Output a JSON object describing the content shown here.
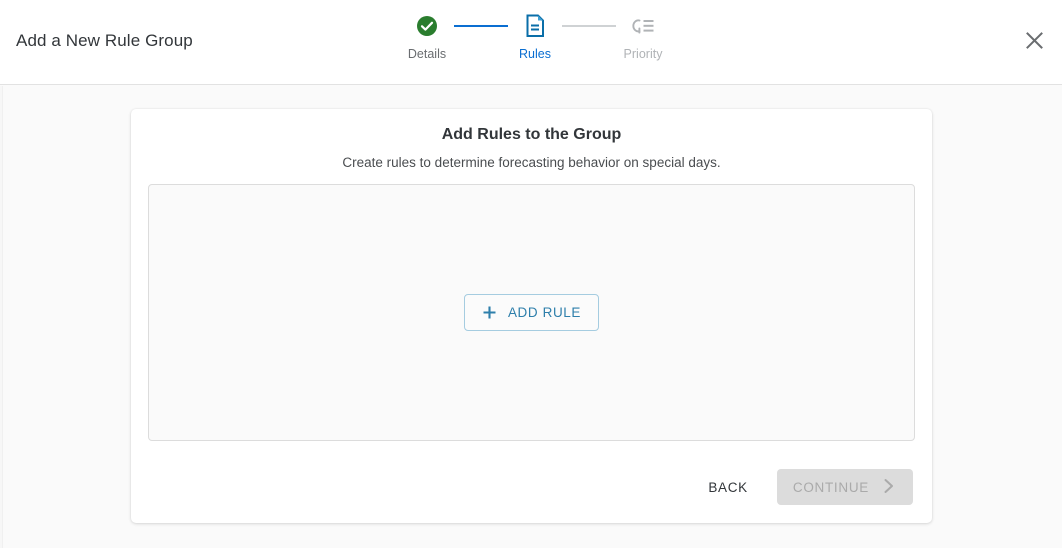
{
  "header": {
    "title": "Add a New Rule Group",
    "close_icon": "close-icon"
  },
  "stepper": {
    "steps": [
      {
        "label": "Details",
        "state": "done",
        "icon": "check-circle-icon"
      },
      {
        "label": "Rules",
        "state": "active",
        "icon": "document-icon"
      },
      {
        "label": "Priority",
        "state": "todo",
        "icon": "priority-list-icon"
      }
    ],
    "connectors": [
      "done",
      "todo"
    ],
    "colors": {
      "done": "#2a7d2e",
      "active": "#0a6ed1",
      "todo": "#b0b3b6"
    }
  },
  "card": {
    "title": "Add Rules to the Group",
    "subtitle": "Create rules to determine forecasting behavior on special days.",
    "empty_area": {
      "add_rule_label": "ADD RULE",
      "plus_icon": "plus-icon"
    },
    "footer": {
      "back_label": "BACK",
      "continue_label": "CONTINUE",
      "continue_disabled": true,
      "chevron_icon": "chevron-right-icon"
    }
  },
  "colors": {
    "accent_blue": "#0a6ed1",
    "add_rule_blue": "#2e7fab",
    "success_green": "#2a7d2e",
    "page_background": "#fafafa",
    "card_background": "#ffffff"
  }
}
